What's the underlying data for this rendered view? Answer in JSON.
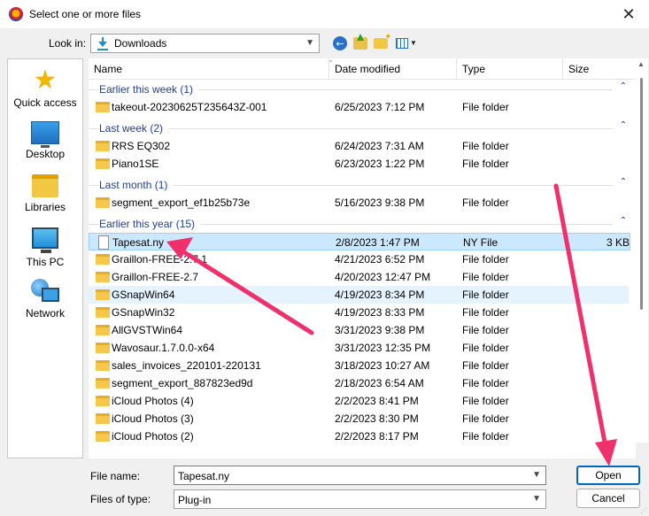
{
  "window": {
    "title": "Select one or more files"
  },
  "toolbar": {
    "look_in_label": "Look in:",
    "look_in_value": "Downloads"
  },
  "places": [
    "Quick access",
    "Desktop",
    "Libraries",
    "This PC",
    "Network"
  ],
  "columns": {
    "name": "Name",
    "date": "Date modified",
    "type": "Type",
    "size": "Size"
  },
  "groups": [
    {
      "title": "Earlier this week (1)",
      "rows": [
        {
          "name": "takeout-20230625T235643Z-001",
          "date": "6/25/2023 7:12 PM",
          "type": "File folder",
          "size": ""
        }
      ]
    },
    {
      "title": "Last week (2)",
      "rows": [
        {
          "name": "RRS EQ302",
          "date": "6/24/2023 7:31 AM",
          "type": "File folder",
          "size": ""
        },
        {
          "name": "Piano1SE",
          "date": "6/23/2023 1:22 PM",
          "type": "File folder",
          "size": ""
        }
      ]
    },
    {
      "title": "Last month (1)",
      "rows": [
        {
          "name": "segment_export_ef1b25b73e",
          "date": "5/16/2023 9:38 PM",
          "type": "File folder",
          "size": ""
        }
      ]
    },
    {
      "title": "Earlier this year (15)",
      "rows": [
        {
          "name": "Tapesat.ny",
          "date": "2/8/2023 1:47 PM",
          "type": "NY File",
          "size": "3 KB"
        },
        {
          "name": "Graillon-FREE-2.7.1",
          "date": "4/21/2023 6:52 PM",
          "type": "File folder",
          "size": ""
        },
        {
          "name": "Graillon-FREE-2.7",
          "date": "4/20/2023 12:47 PM",
          "type": "File folder",
          "size": ""
        },
        {
          "name": "GSnapWin64",
          "date": "4/19/2023 8:34 PM",
          "type": "File folder",
          "size": ""
        },
        {
          "name": "GSnapWin32",
          "date": "4/19/2023 8:33 PM",
          "type": "File folder",
          "size": ""
        },
        {
          "name": "AllGVSTWin64",
          "date": "3/31/2023 9:38 PM",
          "type": "File folder",
          "size": ""
        },
        {
          "name": "Wavosaur.1.7.0.0-x64",
          "date": "3/31/2023 12:35 PM",
          "type": "File folder",
          "size": ""
        },
        {
          "name": "sales_invoices_220101-220131",
          "date": "3/18/2023 10:27 AM",
          "type": "File folder",
          "size": ""
        },
        {
          "name": "segment_export_887823ed9d",
          "date": "2/18/2023 6:54 AM",
          "type": "File folder",
          "size": ""
        },
        {
          "name": "iCloud Photos (4)",
          "date": "2/2/2023 8:41 PM",
          "type": "File folder",
          "size": ""
        },
        {
          "name": "iCloud Photos (3)",
          "date": "2/2/2023 8:30 PM",
          "type": "File folder",
          "size": ""
        },
        {
          "name": "iCloud Photos (2)",
          "date": "2/2/2023 8:17 PM",
          "type": "File folder",
          "size": ""
        }
      ]
    }
  ],
  "footer": {
    "file_name_label": "File name:",
    "file_name_value": "Tapesat.ny",
    "file_type_label": "Files of type:",
    "file_type_value": "Plug-in",
    "open_label": "Open",
    "cancel_label": "Cancel"
  },
  "annotation": {
    "arrow_color": "#f0306a"
  }
}
